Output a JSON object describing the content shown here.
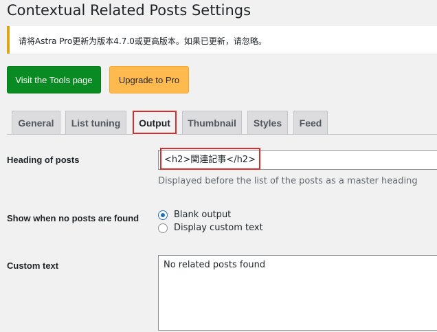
{
  "page": {
    "title": "Contextual Related Posts Settings"
  },
  "notice": {
    "text": "请将Astra Pro更新为版本4.7.0或更高版本。如果已更新，请忽略。"
  },
  "buttons": {
    "tools": "Visit the Tools page",
    "upgrade": "Upgrade to Pro"
  },
  "tabs": [
    {
      "label": "General"
    },
    {
      "label": "List tuning"
    },
    {
      "label": "Output"
    },
    {
      "label": "Thumbnail"
    },
    {
      "label": "Styles"
    },
    {
      "label": "Feed"
    }
  ],
  "active_tab": "Output",
  "highlight_color": "#d62d2d",
  "fields": {
    "heading": {
      "label": "Heading of posts",
      "value": "<h2>関連記事</h2>",
      "description": "Displayed before the list of the posts as a master heading"
    },
    "no_posts": {
      "label": "Show when no posts are found",
      "options": [
        {
          "label": "Blank output",
          "selected": true
        },
        {
          "label": "Display custom text",
          "selected": false
        }
      ]
    },
    "custom_text": {
      "label": "Custom text",
      "value": "No related posts found"
    }
  }
}
